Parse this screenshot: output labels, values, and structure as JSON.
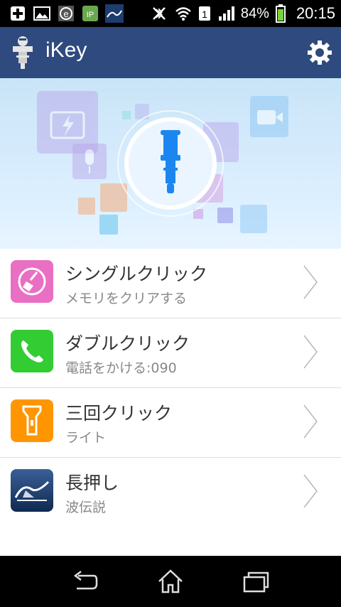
{
  "status_bar": {
    "battery_percent": "84%",
    "time": "20:15",
    "sim_slot": "1",
    "icons": [
      "plus-icon",
      "image-icon",
      "e-browser-icon",
      "ip-messenger-icon",
      "wave-app-icon",
      "bluetooth-off-icon",
      "wifi-icon",
      "sim-1-icon",
      "signal-icon",
      "battery-icon"
    ]
  },
  "app_bar": {
    "title": "iKey",
    "logo_icon": "ikey-logo-icon",
    "settings_icon": "gear-icon",
    "color": "#2f4a7e"
  },
  "banner": {
    "center_icon": "ikey-plug-icon"
  },
  "items": [
    {
      "title": "シングルクリック",
      "subtitle": "メモリをクリアする",
      "icon": "broom-icon",
      "color": "#e96fc4"
    },
    {
      "title": "ダブルクリック",
      "subtitle": "電話をかける:090",
      "icon": "phone-icon",
      "color": "#33cc33"
    },
    {
      "title": "三回クリック",
      "subtitle": "ライト",
      "icon": "flashlight-icon",
      "color": "#ff9500"
    },
    {
      "title": "長押し",
      "subtitle": "波伝説",
      "icon": "wave-app-icon",
      "color": "#1d3d6e"
    }
  ],
  "nav_bar": {
    "back_icon": "back-icon",
    "home_icon": "home-icon",
    "recents_icon": "recents-icon"
  }
}
